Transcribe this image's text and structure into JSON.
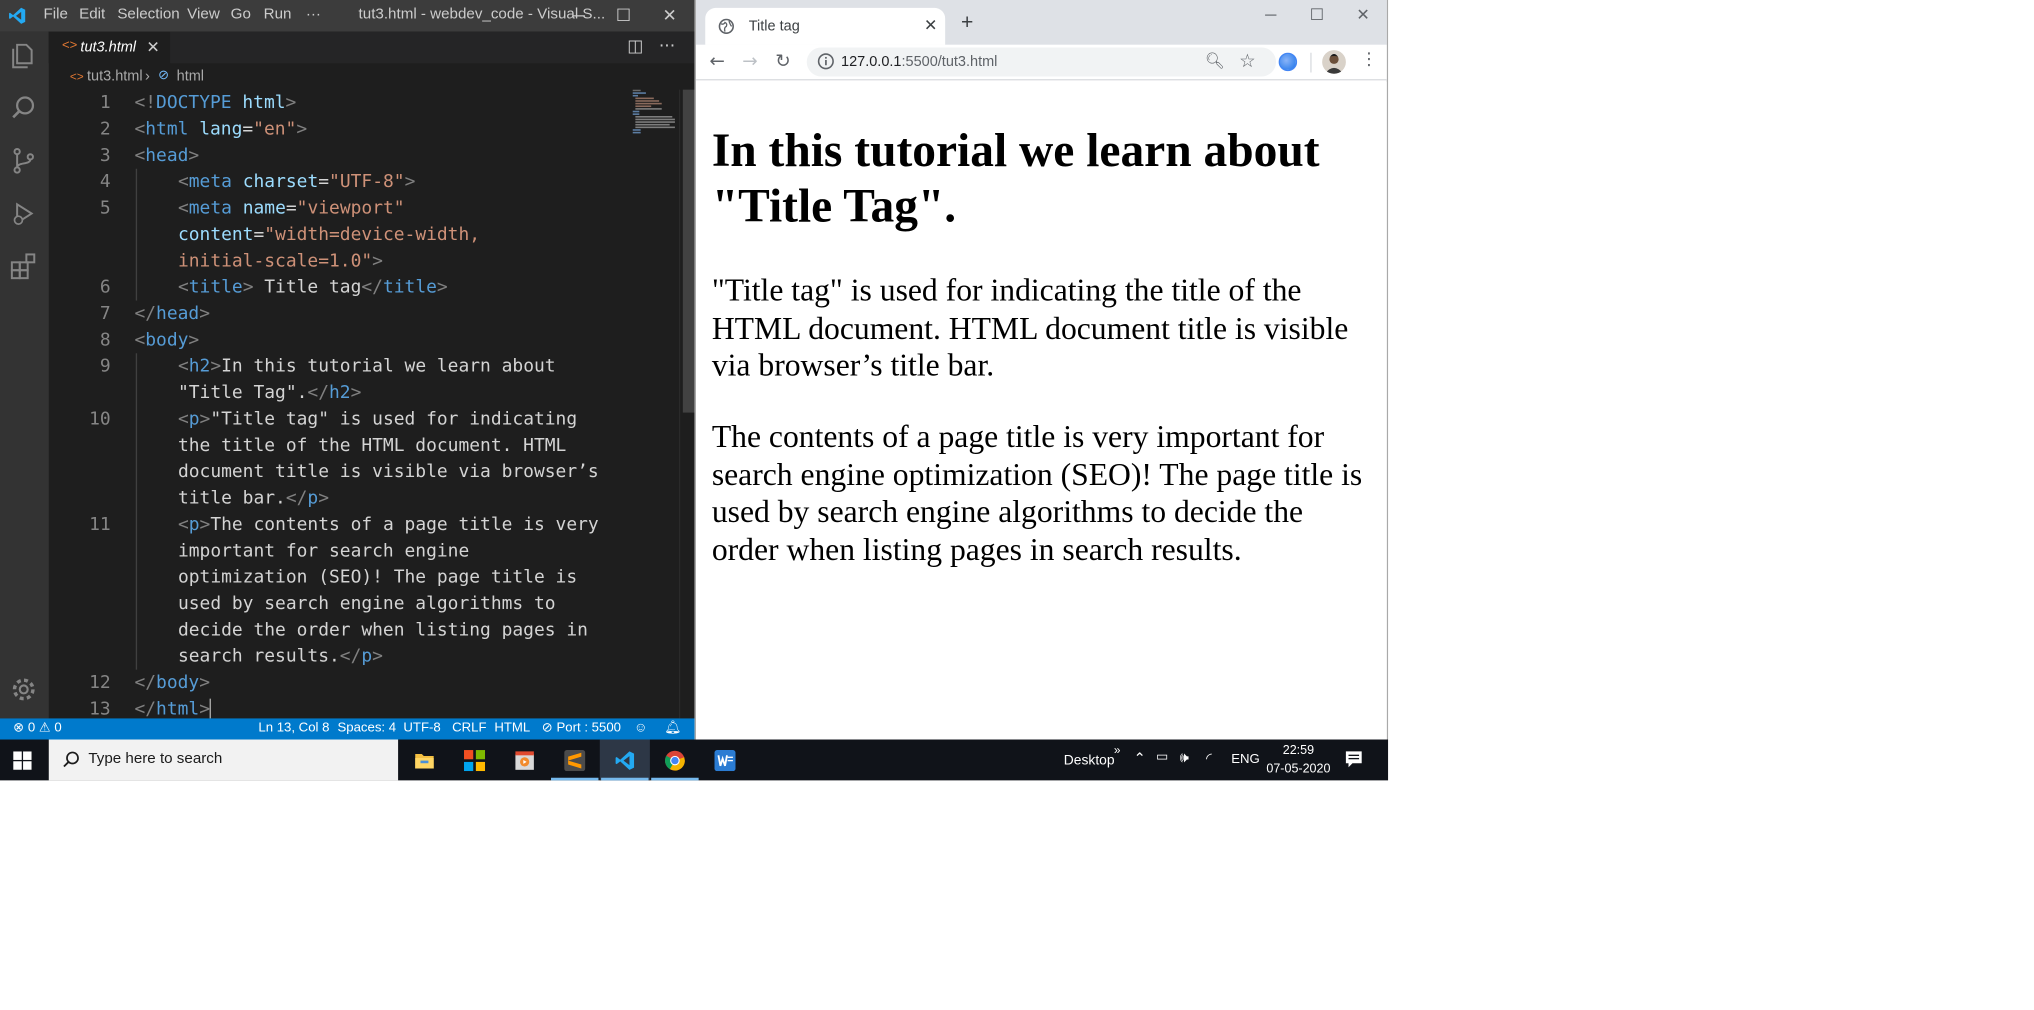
{
  "vscode": {
    "menu": [
      "File",
      "Edit",
      "Selection",
      "View",
      "Go",
      "Run",
      "···"
    ],
    "window_title": "tut3.html - webdev_code - Visual S...",
    "tab": {
      "label": "tut3.html",
      "close": "✕"
    },
    "breadcrumb": {
      "file": "tut3.html",
      "sep": "›",
      "node": "html"
    },
    "code_lines": [
      {
        "n": "1",
        "html": "<span class=\"tg\">&lt;!</span><span class=\"tn\">DOCTYPE</span> <span class=\"at\">html</span><span class=\"tg\">&gt;</span>",
        "indent": 0
      },
      {
        "n": "2",
        "html": "<span class=\"tg\">&lt;</span><span class=\"tn\">html</span> <span class=\"at\">lang</span>=<span class=\"st\">\"en\"</span><span class=\"tg\">&gt;</span>",
        "indent": 0
      },
      {
        "n": "3",
        "html": "<span class=\"tg\">&lt;</span><span class=\"tn\">head</span><span class=\"tg\">&gt;</span>",
        "indent": 0
      },
      {
        "n": "4",
        "html": "<span class=\"tg\">&lt;</span><span class=\"tn\">meta</span> <span class=\"at\">charset</span>=<span class=\"st\">\"UTF-8\"</span><span class=\"tg\">&gt;</span>",
        "indent": 1
      },
      {
        "n": "5",
        "html": "<span class=\"tg\">&lt;</span><span class=\"tn\">meta</span> <span class=\"at\">name</span>=<span class=\"st\">\"viewport\"</span>",
        "indent": 1
      },
      {
        "n": "",
        "html": "<span class=\"at\">content</span>=<span class=\"st\">\"width=device-width,</span>",
        "indent": 1
      },
      {
        "n": "",
        "html": "<span class=\"st\">initial-scale=1.0\"</span><span class=\"tg\">&gt;</span>",
        "indent": 1
      },
      {
        "n": "6",
        "html": "<span class=\"tg\">&lt;</span><span class=\"tn\">title</span><span class=\"tg\">&gt;</span> Title tag<span class=\"tg\">&lt;/</span><span class=\"tn\">title</span><span class=\"tg\">&gt;</span>",
        "indent": 1
      },
      {
        "n": "7",
        "html": "<span class=\"tg\">&lt;/</span><span class=\"tn\">head</span><span class=\"tg\">&gt;</span>",
        "indent": 0
      },
      {
        "n": "8",
        "html": "<span class=\"tg\">&lt;</span><span class=\"tn\">body</span><span class=\"tg\">&gt;</span>",
        "indent": 0
      },
      {
        "n": "9",
        "html": "<span class=\"tg\">&lt;</span><span class=\"tn\">h2</span><span class=\"tg\">&gt;</span>In this tutorial we learn about",
        "indent": 1
      },
      {
        "n": "",
        "html": "\"Title Tag\".<span class=\"tg\">&lt;/</span><span class=\"tn\">h2</span><span class=\"tg\">&gt;</span>",
        "indent": 1
      },
      {
        "n": "10",
        "html": "<span class=\"tg\">&lt;</span><span class=\"tn\">p</span><span class=\"tg\">&gt;</span>\"Title tag\" is used for indicating",
        "indent": 1
      },
      {
        "n": "",
        "html": "the title of the HTML document. HTML",
        "indent": 1
      },
      {
        "n": "",
        "html": "document title is visible via browser’s",
        "indent": 1
      },
      {
        "n": "",
        "html": "title bar.<span class=\"tg\">&lt;/</span><span class=\"tn\">p</span><span class=\"tg\">&gt;</span>",
        "indent": 1
      },
      {
        "n": "11",
        "html": "<span class=\"tg\">&lt;</span><span class=\"tn\">p</span><span class=\"tg\">&gt;</span>The contents of a page title is very",
        "indent": 1
      },
      {
        "n": "",
        "html": "important for search engine",
        "indent": 1
      },
      {
        "n": "",
        "html": "optimization (SEO)! The page title is",
        "indent": 1
      },
      {
        "n": "",
        "html": "used by search engine algorithms to",
        "indent": 1
      },
      {
        "n": "",
        "html": "decide the order when listing pages in",
        "indent": 1
      },
      {
        "n": "",
        "html": "search results.<span class=\"tg\">&lt;/</span><span class=\"tn\">p</span><span class=\"tg\">&gt;</span>",
        "indent": 1
      },
      {
        "n": "12",
        "html": "<span class=\"tg\">&lt;/</span><span class=\"tn\">body</span><span class=\"tg\">&gt;</span>",
        "indent": 0
      },
      {
        "n": "13",
        "html": "<span class=\"tg\">&lt;/</span><span class=\"tn\">html</span><span class=\"tg\">&gt;</span>",
        "indent": 0
      }
    ],
    "status": {
      "problems": "⊗ 0 ⚠ 0",
      "position": "Ln 13, Col 8",
      "spaces": "Spaces: 4",
      "encoding": "UTF-8",
      "eol": "CRLF",
      "language": "HTML",
      "port": "⊘ Port : 5500"
    }
  },
  "chrome": {
    "tab_title": "Title tag",
    "tab_close": "✕",
    "new_tab": "+",
    "url_host": "127.0.0.1",
    "url_path": ":5500/tut3.html",
    "page": {
      "heading": "In this tutorial we learn about \"Title Tag\".",
      "p1": "\"Title tag\" is used for indicating the title of the HTML document. HTML document title is visible via browser’s title bar.",
      "p2": "The contents of a page title is very important for search engine optimization (SEO)! The page title is used by search engine algorithms to decide the order when listing pages in search results."
    }
  },
  "taskbar": {
    "search_placeholder": "Type here to search",
    "desktop_label": "Desktop",
    "chevron": "»",
    "language": "ENG",
    "time": "22:59",
    "date": "07-05-2020"
  },
  "colors": {
    "vscode_bg": "#1e1e1e",
    "status_bar": "#007acc",
    "taskbar": "#101319",
    "chrome_tabstrip": "#dee1e6"
  }
}
